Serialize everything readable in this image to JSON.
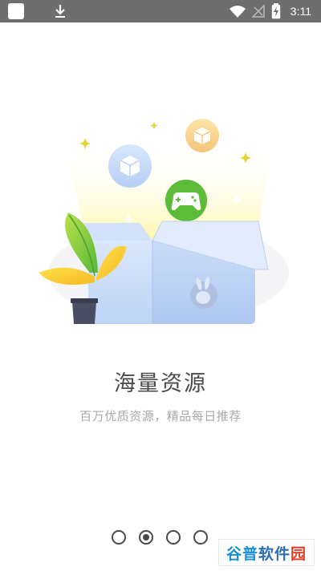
{
  "status_bar": {
    "time": "3:11",
    "icons": [
      "app-square-icon",
      "download-icon",
      "wifi-icon",
      "no-signal-icon",
      "battery-charging-icon"
    ]
  },
  "onboarding": {
    "title": "海量资源",
    "subtitle": "百万优质资源，精品每日推荐",
    "page_count": 4,
    "active_page": 2
  },
  "watermark": {
    "part1": "谷普",
    "part2": "软件",
    "part3": "园"
  },
  "colors": {
    "status_bar": "#6e6e6e",
    "title_text": "#4a4a4a",
    "subtitle_text": "#a8a8a8",
    "box": "#c8daf6",
    "game_icon": "#5dbb3a",
    "glow": "#fdf7a6"
  }
}
